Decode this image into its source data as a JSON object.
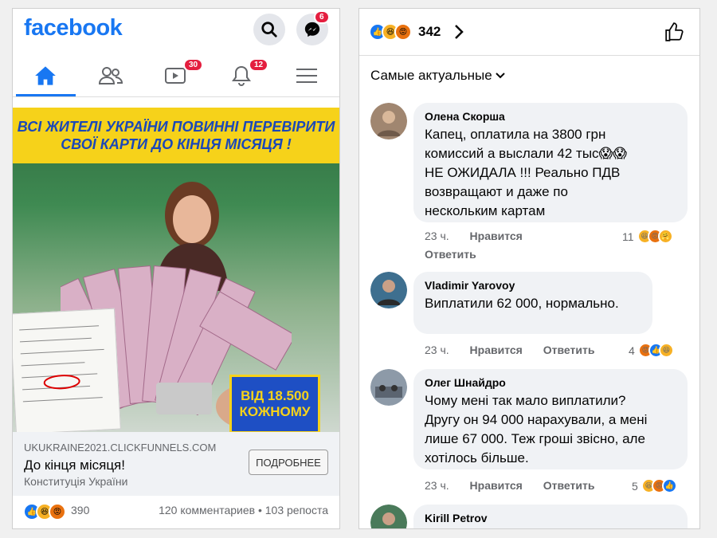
{
  "left": {
    "logo": "facebook",
    "messenger_badge": "6",
    "watch_badge": "30",
    "notif_badge": "12",
    "ad": {
      "banner_line1": "ВСІ ЖИТЕЛІ УКРАЇНИ ПОВИННІ ПЕРЕВІРИТИ",
      "banner_line2": "СВОЇ КАРТИ ДО КІНЦЯ МІСЯЦЯ !",
      "promo_line1": "ВІД 18.500",
      "promo_line2": "КОЖНОМУ",
      "domain": "UKUKRAINE2021.CLICKFUNNELS.COM",
      "title": "До кінця місяця!",
      "subtitle": "Конституція України",
      "cta": "ПОДРОБНЕЕ"
    },
    "reactions_count": "390",
    "comments": "120 комментариев",
    "separator": "•",
    "shares": "103 репоста"
  },
  "right": {
    "reactions_count": "342",
    "sort_label": "Самые актуальные",
    "comments": [
      {
        "name": "Олена Скорша",
        "text": [
          "Капец, оплатила на 3800 грн",
          "комиссий а выслали 42 тыс😱😱",
          "НЕ ОЖИДАЛА !!! Реально ПДВ",
          "возвращают и даже по",
          "нескольким картам"
        ],
        "time": "23 ч.",
        "like": "Нравится",
        "reply": "Ответить",
        "react_count": "11"
      },
      {
        "name": "Vladimir Yarovoy",
        "text": [
          "Виплатили 62 000, нормально."
        ],
        "time": "23 ч.",
        "like": "Нравится",
        "reply": "Ответить",
        "react_count": "4"
      },
      {
        "name": "Олег Шнайдро",
        "text": [
          "Чому мені так мало виплатили?",
          "Другу он 94 000 нарахували, а мені",
          "лише 67 000. Теж гроші звісно, але",
          "хотілось більше."
        ],
        "time": "23 ч.",
        "like": "Нравится",
        "reply": "Ответить",
        "react_count": "5"
      },
      {
        "name": "Kirill Petrov"
      }
    ]
  },
  "colors": {
    "brand": "#1877f2",
    "badge": "#e41e3f",
    "banner": "#f6d21a"
  }
}
